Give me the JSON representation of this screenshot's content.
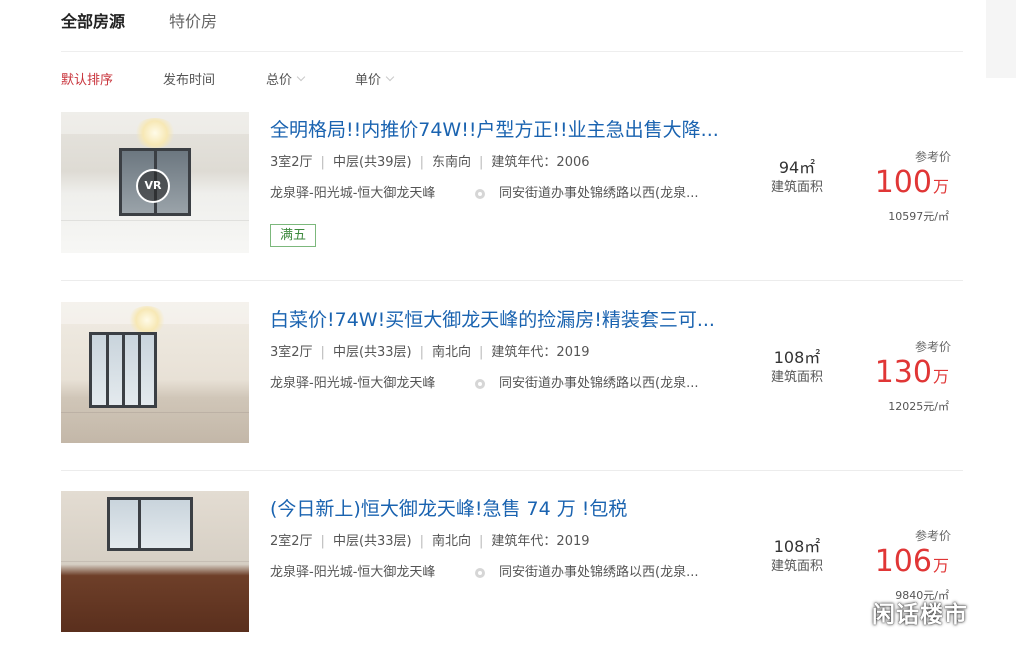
{
  "tabs": [
    {
      "label": "全部房源",
      "active": true
    },
    {
      "label": "特价房",
      "active": false
    }
  ],
  "sort_options": [
    {
      "label": "默认排序",
      "active": true,
      "has_caret": false
    },
    {
      "label": "发布时间",
      "active": false,
      "has_caret": false
    },
    {
      "label": "总价",
      "active": false,
      "has_caret": true
    },
    {
      "label": "单价",
      "active": false,
      "has_caret": true
    }
  ],
  "listings": [
    {
      "title": "全明格局!!内推价74W!!户型方正!!业主急出售大降...",
      "layout": "3室2厅",
      "floor": "中层(共39层)",
      "orientation": "东南向",
      "year": "建筑年代：2006",
      "community": "龙泉驿-阳光城-恒大御龙天峰",
      "address": "同安街道办事处锦绣路以西(龙泉...",
      "area": "94㎡",
      "area_label": "建筑面积",
      "price_label": "参考价",
      "price": "100",
      "price_unit": "万",
      "unit_price": "10597元/㎡",
      "tag": "满五",
      "vr_label": "VR",
      "photo_icon": "vr-tour-photo"
    },
    {
      "title": "白菜价!74W!买恒大御龙天峰的捡漏房!精装套三可...",
      "layout": "3室2厅",
      "floor": "中层(共33层)",
      "orientation": "南北向",
      "year": "建筑年代：2019",
      "community": "龙泉驿-阳光城-恒大御龙天峰",
      "address": "同安街道办事处锦绣路以西(龙泉...",
      "area": "108㎡",
      "area_label": "建筑面积",
      "price_label": "参考价",
      "price": "130",
      "price_unit": "万",
      "unit_price": "12025元/㎡"
    },
    {
      "title": "(今日新上)恒大御龙天峰!急售 74 万 !包税",
      "layout": "2室2厅",
      "floor": "中层(共33层)",
      "orientation": "南北向",
      "year": "建筑年代：2019",
      "community": "龙泉驿-阳光城-恒大御龙天峰",
      "address": "同安街道办事处锦绣路以西(龙泉...",
      "area": "108㎡",
      "area_label": "建筑面积",
      "price_label": "参考价",
      "price": "106",
      "price_unit": "万",
      "unit_price": "9840元/㎡"
    }
  ],
  "watermark": "闲话楼市",
  "colors": {
    "accent_red": "#e03636",
    "sort_active": "#c8323a",
    "title_blue": "#1a63b0",
    "tag_green": "#3e8a3e"
  }
}
